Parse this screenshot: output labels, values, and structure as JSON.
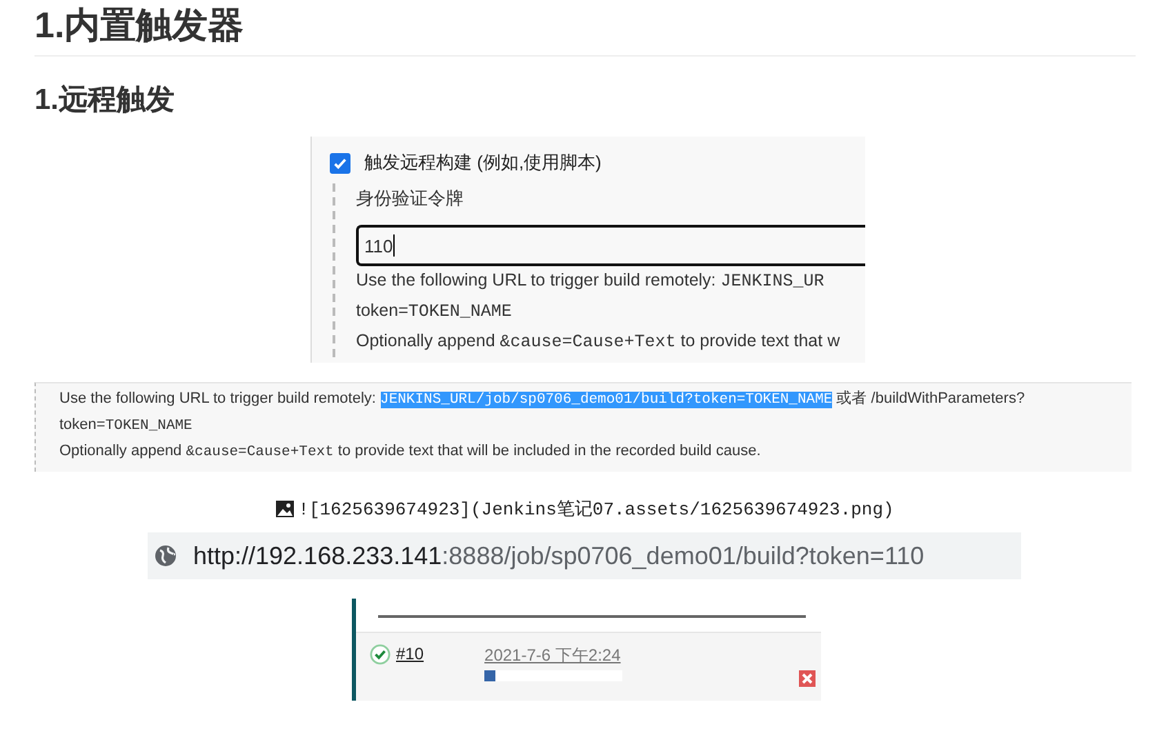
{
  "heading_1": "1.内置触发器",
  "heading_2": "1.远程触发",
  "trigger_panel": {
    "checkbox": {
      "label": "触发远程构建 (例如,使用脚本)",
      "checked": true
    },
    "field_label": "身份验证令牌",
    "token_value": "110",
    "help_lines": [
      [
        {
          "kind": "plain",
          "text": "Use the following URL to trigger build remotely: "
        },
        {
          "kind": "mono",
          "text": "JENKINS_UR"
        }
      ],
      [
        {
          "kind": "plain",
          "text": "token="
        },
        {
          "kind": "mono",
          "text": "TOKEN_NAME"
        }
      ],
      [
        {
          "kind": "plain",
          "text": "Optionally append "
        },
        {
          "kind": "mono",
          "text": "&cause=Cause+Text"
        },
        {
          "kind": "plain",
          "text": " to provide text that w"
        }
      ]
    ]
  },
  "help_panel": {
    "lines": [
      [
        {
          "kind": "plain",
          "text": "Use the following URL to trigger build remotely: "
        },
        {
          "kind": "selected",
          "text": "JENKINS_URL/job/sp0706_demo01/build?token=TOKEN_NAME"
        },
        {
          "kind": "plain",
          "text": " 或者 /buildWithParameters?"
        }
      ],
      [
        {
          "kind": "plain",
          "text": "token="
        },
        {
          "kind": "mono",
          "text": "TOKEN_NAME"
        }
      ],
      [
        {
          "kind": "plain",
          "text": "Optionally append "
        },
        {
          "kind": "mono",
          "text": "&cause=Cause+Text"
        },
        {
          "kind": "plain",
          "text": " to provide text that will be included in the recorded build cause."
        }
      ]
    ]
  },
  "image_alt": "![1625639674923](Jenkins笔记07.assets/1625639674923.png)",
  "address_bar": {
    "host": "http://192.168.233.141",
    "rest": ":8888/job/sp0706_demo01/build?token=110"
  },
  "build_row": {
    "number": "#10",
    "time": "2021-7-6 下午2:24",
    "level": 0.08
  }
}
